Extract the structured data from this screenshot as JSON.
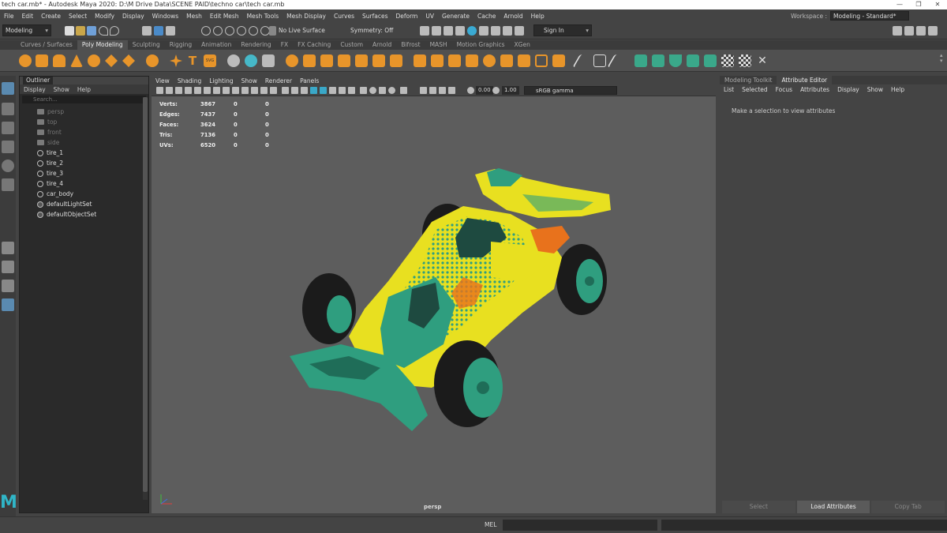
{
  "title_bar": {
    "text": "tech car.mb* - Autodesk Maya 2020: D:\\M Drive Data\\SCENE PAID\\techno car\\tech car.mb",
    "minimize": "—",
    "maximize": "❐",
    "close": "✕"
  },
  "menu": [
    "File",
    "Edit",
    "Create",
    "Select",
    "Modify",
    "Display",
    "Windows",
    "Mesh",
    "Edit Mesh",
    "Mesh Tools",
    "Mesh Display",
    "Curves",
    "Surfaces",
    "Deform",
    "UV",
    "Generate",
    "Cache",
    "Arnold",
    "Help"
  ],
  "workspace": {
    "label": "Workspace :",
    "value": "Modeling - Standard*"
  },
  "status_line": {
    "menu_set": "Modeling",
    "live_surface": "No Live Surface",
    "symmetry": "Symmetry: Off",
    "sign_in": "Sign In"
  },
  "shelf_tabs": [
    "Curves / Surfaces",
    "Poly Modeling",
    "Sculpting",
    "Rigging",
    "Animation",
    "Rendering",
    "FX",
    "FX Caching",
    "Custom",
    "Arnold",
    "Bifrost",
    "MASH",
    "Motion Graphics",
    "XGen"
  ],
  "shelf_active": "Poly Modeling",
  "shelf_text_icon": "T",
  "shelf_svg_icon": "SVG",
  "outliner": {
    "tab": "Outliner",
    "menu": [
      "Display",
      "Show",
      "Help"
    ],
    "search_placeholder": "Search...",
    "items": [
      {
        "label": "persp",
        "type": "cam",
        "dim": true
      },
      {
        "label": "top",
        "type": "cam",
        "dim": true
      },
      {
        "label": "front",
        "type": "cam",
        "dim": true
      },
      {
        "label": "side",
        "type": "cam",
        "dim": true
      },
      {
        "label": "tire_1",
        "type": "mesh",
        "dim": false
      },
      {
        "label": "tire_2",
        "type": "mesh",
        "dim": false
      },
      {
        "label": "tire_3",
        "type": "mesh",
        "dim": false
      },
      {
        "label": "tire_4",
        "type": "mesh",
        "dim": false
      },
      {
        "label": "car_body",
        "type": "mesh",
        "dim": false
      },
      {
        "label": "defaultLightSet",
        "type": "set",
        "dim": false
      },
      {
        "label": "defaultObjectSet",
        "type": "set",
        "dim": false
      }
    ]
  },
  "logo": "M",
  "viewport": {
    "menu": [
      "View",
      "Shading",
      "Lighting",
      "Show",
      "Renderer",
      "Panels"
    ],
    "exposure": "0.00",
    "gamma": "1.00",
    "color_space": "sRGB gamma",
    "camera": "persp",
    "hud": [
      {
        "k": "Verts:",
        "v": "3867",
        "a": "0",
        "b": "0"
      },
      {
        "k": "Edges:",
        "v": "7437",
        "a": "0",
        "b": "0"
      },
      {
        "k": "Faces:",
        "v": "3624",
        "a": "0",
        "b": "0"
      },
      {
        "k": "Tris:",
        "v": "7136",
        "a": "0",
        "b": "0"
      },
      {
        "k": "UVs:",
        "v": "6520",
        "a": "0",
        "b": "0"
      }
    ]
  },
  "attribute_panel": {
    "tabs": [
      "Modeling Toolkit",
      "Attribute Editor"
    ],
    "active_tab": "Attribute Editor",
    "menu": [
      "List",
      "Selected",
      "Focus",
      "Attributes",
      "Display",
      "Show",
      "Help"
    ],
    "message": "Make a selection to view attributes",
    "buttons": [
      "Select",
      "Load Attributes",
      "Copy Tab"
    ]
  },
  "command_line": {
    "label": "MEL"
  },
  "colors": {
    "car_yellow": "#e8e020",
    "car_teal": "#2f9e7f",
    "car_dark": "#1e2e2a",
    "tire": "#1b1b1b",
    "accent_orange": "#e8721c",
    "maya_blue": "#30b5c7"
  }
}
